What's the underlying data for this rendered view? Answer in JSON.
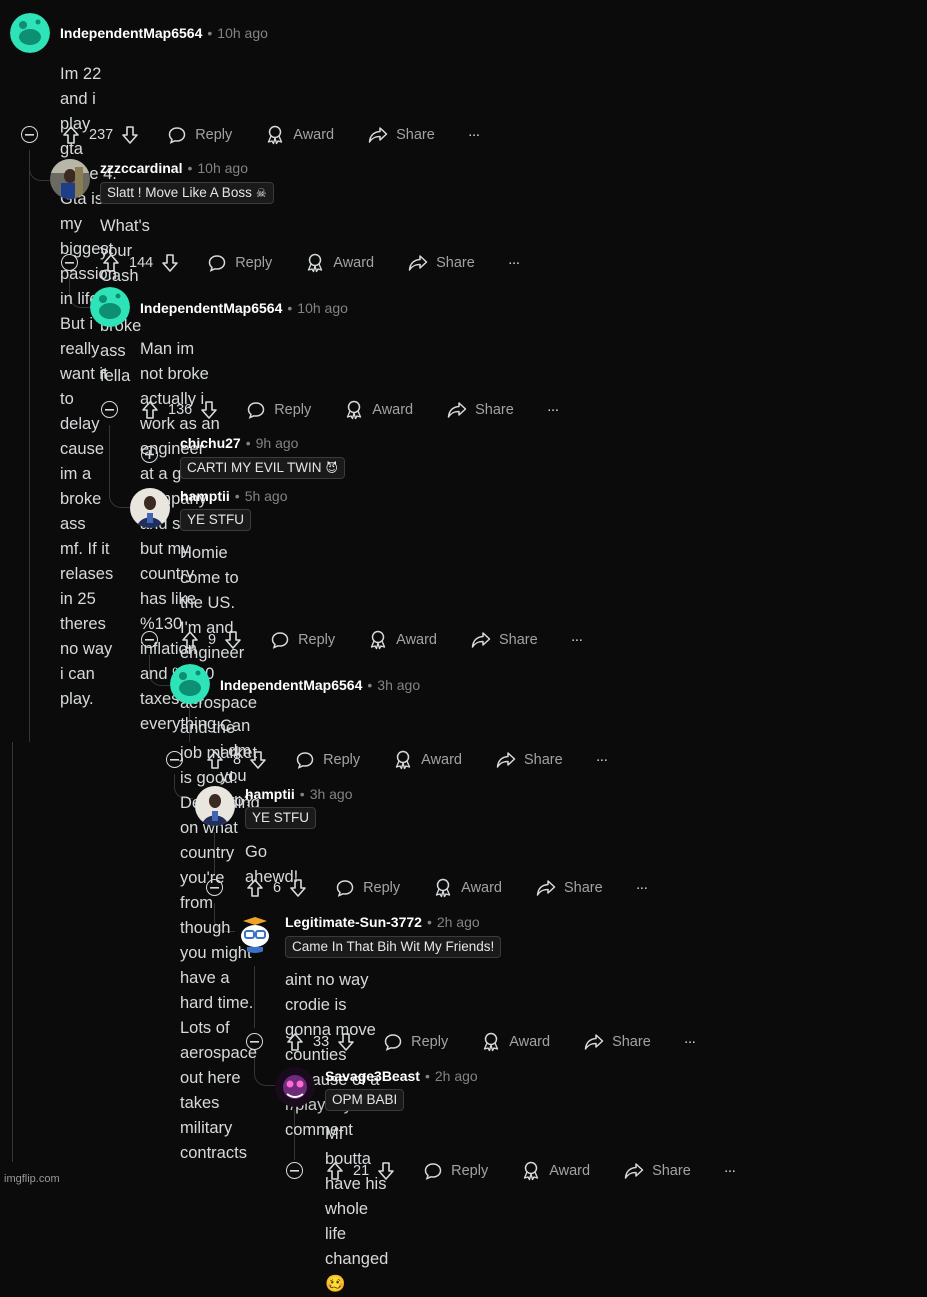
{
  "colors": {
    "background": "#0b0b0b",
    "text": "#d7dadc",
    "muted": "#818384",
    "thread_line": "#343536",
    "snoo_green": "#2ee3b8"
  },
  "watermark": "imgflip.com",
  "comments": [
    {
      "username": "IndependentMap6564",
      "time": "10h ago",
      "avatar": "snoo-icon",
      "body": [
        "Im 22 and i play gta since 4. Gta is my biggest passion in life. But i really want it to delay cause im a broke ass",
        "mf. If it relases in 25 theres no way i can play."
      ],
      "score": "237",
      "reply": "Reply",
      "award": "Award",
      "share": "Share",
      "more": "···",
      "collapse": "minus"
    },
    {
      "username": "zzzccardinal",
      "time": "10h ago",
      "avatar": "photo",
      "flair": "Slatt ! Move Like A Boss",
      "flair_emoji": "☠",
      "body": [
        "What's your Cash app broke ass fella"
      ],
      "score": "144",
      "reply": "Reply",
      "award": "Award",
      "share": "Share",
      "more": "···",
      "collapse": "minus"
    },
    {
      "username": "IndependentMap6564",
      "time": "10h ago",
      "avatar": "snoo-icon",
      "body": [
        "Man im not broke actually i work as an engineer at a good company and shi but my country has like",
        "%130 inflation and %200 taxes on everything."
      ],
      "score": "136",
      "reply": "Reply",
      "award": "Award",
      "share": "Share",
      "more": "···",
      "collapse": "minus"
    },
    {
      "username": "chichu27",
      "time": "9h ago",
      "avatar": "none",
      "flair": "CARTI MY EVIL TWIN",
      "flair_emoji": "😈",
      "collapse": "plus"
    },
    {
      "username": "hamptii",
      "time": "5h ago",
      "avatar": "photo",
      "flair": "YE STFU",
      "body": [
        "Homie come to the US. I'm and engineer in aerospace and the job market is good. Depending",
        "on what country you're from though you might have a hard time. Lots of aerospace out here",
        "takes military contracts"
      ],
      "score": "9",
      "reply": "Reply",
      "award": "Award",
      "share": "Share",
      "more": "···",
      "collapse": "minus"
    },
    {
      "username": "IndependentMap6564",
      "time": "3h ago",
      "avatar": "snoo-icon",
      "body": [
        "Can i dm you bro?"
      ],
      "score": "8",
      "reply": "Reply",
      "award": "Award",
      "share": "Share",
      "more": "···",
      "collapse": "minus"
    },
    {
      "username": "hamptii",
      "time": "3h ago",
      "avatar": "photo",
      "flair": "YE STFU",
      "body": [
        "Go ahewd!"
      ],
      "score": "6",
      "reply": "Reply",
      "award": "Award",
      "share": "Share",
      "more": "···",
      "collapse": "minus"
    },
    {
      "username": "Legitimate-Sun-3772",
      "time": "2h ago",
      "avatar": "snoo-glasses-icon",
      "flair": "Came In That Bih Wit My Friends!",
      "body_prefix": "aint no way crodie is gonna move counties because of a ",
      "body_link": "r/playboycarti",
      "body": [
        "comment"
      ],
      "score": "33",
      "reply": "Reply",
      "award": "Award",
      "share": "Share",
      "more": "···",
      "collapse": "minus"
    },
    {
      "username": "Savage3Beast",
      "time": "2h ago",
      "avatar": "photo",
      "flair": "OPM BABI",
      "body_text": "Mf boutta have his whole life changed",
      "body_emoji": "🥴",
      "score": "21",
      "reply": "Reply",
      "award": "Award",
      "share": "Share",
      "more": "···",
      "collapse": "minus"
    }
  ]
}
